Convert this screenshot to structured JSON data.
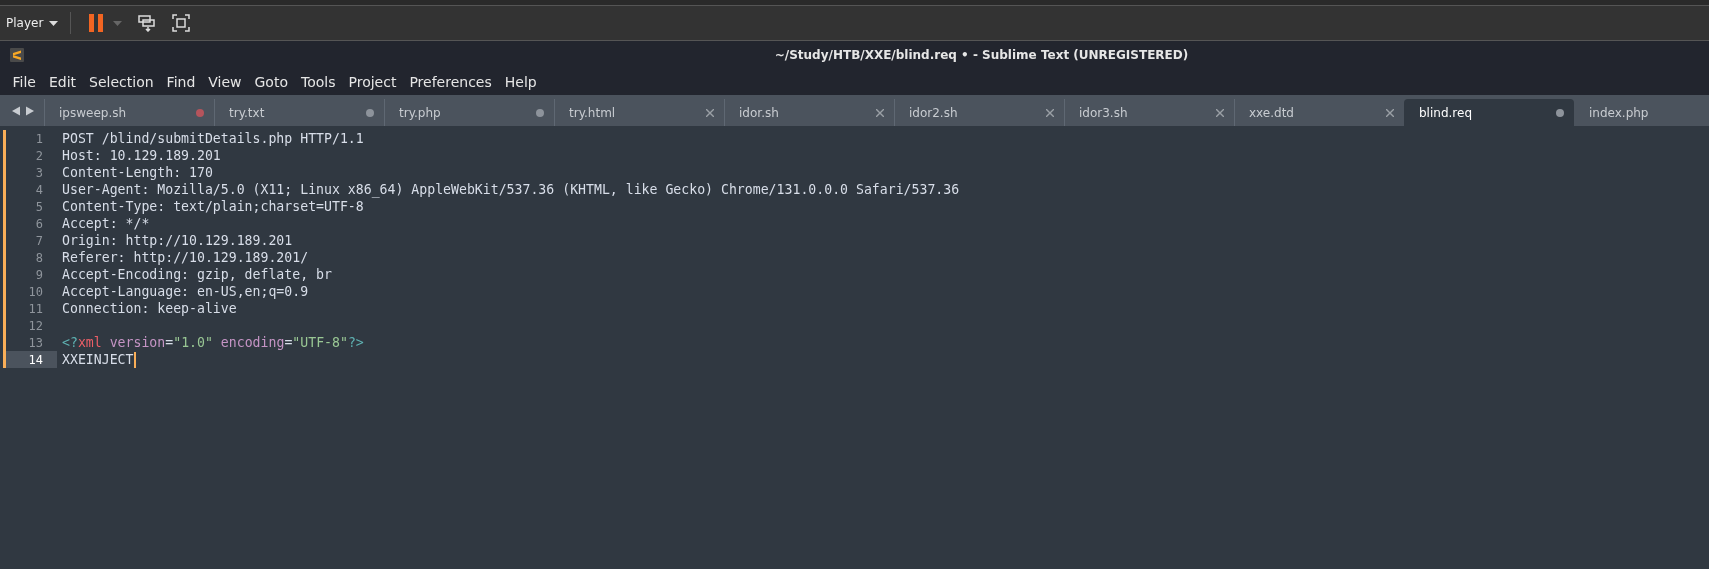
{
  "player_bar": {
    "label": "Player"
  },
  "window": {
    "title": "~/Study/HTB/XXE/blind.req • - Sublime Text (UNREGISTERED)"
  },
  "menu": [
    "File",
    "Edit",
    "Selection",
    "Find",
    "View",
    "Goto",
    "Tools",
    "Project",
    "Preferences",
    "Help"
  ],
  "tabs": [
    {
      "label": "ipsweep.sh",
      "selected": false,
      "kind": "modified",
      "color": "#b5545c"
    },
    {
      "label": "try.txt",
      "selected": false,
      "kind": "modified",
      "color": "#8d939b"
    },
    {
      "label": "try.php",
      "selected": false,
      "kind": "modified",
      "color": "#8d939b"
    },
    {
      "label": "try.html",
      "selected": false,
      "kind": "closable"
    },
    {
      "label": "idor.sh",
      "selected": false,
      "kind": "closable"
    },
    {
      "label": "idor2.sh",
      "selected": false,
      "kind": "closable"
    },
    {
      "label": "idor3.sh",
      "selected": false,
      "kind": "closable"
    },
    {
      "label": "xxe.dtd",
      "selected": false,
      "kind": "closable"
    },
    {
      "label": "blind.req",
      "selected": true,
      "kind": "modified",
      "color": "#8d939b"
    },
    {
      "label": "index.php",
      "selected": false,
      "kind": "cut"
    }
  ],
  "lines": [
    {
      "number": "1",
      "changed": true,
      "current": false,
      "tokens": [
        {
          "text": "POST /blind/submitDetails.php HTTP/1.1",
          "kind": "plain"
        }
      ]
    },
    {
      "number": "2",
      "changed": true,
      "current": false,
      "tokens": [
        {
          "text": "Host: 10.129.189.201",
          "kind": "plain"
        }
      ]
    },
    {
      "number": "3",
      "changed": true,
      "current": false,
      "tokens": [
        {
          "text": "Content-Length: 170",
          "kind": "plain"
        }
      ]
    },
    {
      "number": "4",
      "changed": true,
      "current": false,
      "tokens": [
        {
          "text": "User-Agent: Mozilla/5.0 (X11; Linux x86_64) AppleWebKit/537.36 (KHTML, like Gecko) Chrome/131.0.0.0 Safari/537.36",
          "kind": "plain"
        }
      ]
    },
    {
      "number": "5",
      "changed": true,
      "current": false,
      "tokens": [
        {
          "text": "Content-Type: text/plain;charset=UTF-8",
          "kind": "plain"
        }
      ]
    },
    {
      "number": "6",
      "changed": true,
      "current": false,
      "tokens": [
        {
          "text": "Accept: */*",
          "kind": "plain"
        }
      ]
    },
    {
      "number": "7",
      "changed": true,
      "current": false,
      "tokens": [
        {
          "text": "Origin: http://10.129.189.201",
          "kind": "plain"
        }
      ]
    },
    {
      "number": "8",
      "changed": true,
      "current": false,
      "tokens": [
        {
          "text": "Referer: http://10.129.189.201/",
          "kind": "plain"
        }
      ]
    },
    {
      "number": "9",
      "changed": true,
      "current": false,
      "tokens": [
        {
          "text": "Accept-Encoding: gzip, deflate, br",
          "kind": "plain"
        }
      ]
    },
    {
      "number": "10",
      "changed": true,
      "current": false,
      "tokens": [
        {
          "text": "Accept-Language: en-US,en;q=0.9",
          "kind": "plain"
        }
      ]
    },
    {
      "number": "11",
      "changed": true,
      "current": false,
      "tokens": [
        {
          "text": "Connection: keep-alive",
          "kind": "plain"
        }
      ]
    },
    {
      "number": "12",
      "changed": true,
      "current": false
    },
    {
      "number": "13",
      "changed": true,
      "current": false,
      "tokens": [
        {
          "text": "<?",
          "kind": "punct"
        },
        {
          "text": "xml",
          "kind": "tag"
        },
        {
          "text": "version",
          "kind": "attr"
        },
        {
          "text": "=",
          "kind": "plain"
        },
        {
          "text": "\"1.0\"",
          "kind": "string"
        },
        {
          "text": "encoding",
          "kind": "attr"
        },
        {
          "text": "=",
          "kind": "plain"
        },
        {
          "text": "\"UTF-8\"",
          "kind": "string"
        },
        {
          "text": "?>",
          "kind": "punct"
        }
      ]
    },
    {
      "number": "14",
      "changed": true,
      "current": true,
      "cursor": true,
      "tokens": [
        {
          "text": "XXEINJECT",
          "kind": "plain"
        }
      ]
    }
  ]
}
